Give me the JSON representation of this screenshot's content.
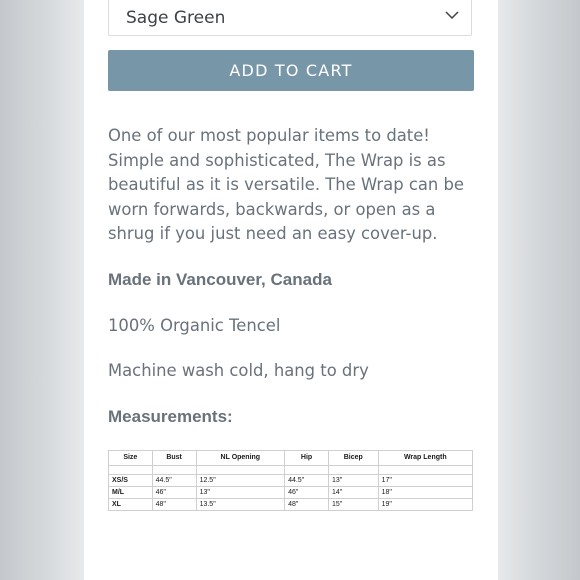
{
  "product": {
    "variant_selected": "Sage Green",
    "add_to_cart_label": "ADD TO CART",
    "description": "One of our most popular items to date! Simple and sophisticated, The Wrap is as beautiful as it is versatile. The Wrap can be worn forwards, backwards, or open as a shrug if you just need an easy cover-up.",
    "made_in": "Made in Vancouver, Canada",
    "material": "100% Organic Tencel",
    "care": "Machine wash cold, hang to dry",
    "measurements_heading": "Measurements:"
  },
  "measurements": {
    "headers": [
      "Size",
      "Bust",
      "NL Opening",
      "Hip",
      "Bicep",
      "Wrap Length"
    ],
    "rows": [
      [
        "XS/S",
        "44.5\"",
        "12.5\"",
        "44.5\"",
        "13\"",
        "17\""
      ],
      [
        "M/L",
        "46\"",
        "13\"",
        "46\"",
        "14\"",
        "18\""
      ],
      [
        "XL",
        "48\"",
        "13.5\"",
        "48\"",
        "15\"",
        "19\""
      ]
    ]
  },
  "colors": {
    "button": "#7796a8",
    "text": "#69727b"
  },
  "icons": {
    "select_arrow": "chevron-down-icon"
  }
}
